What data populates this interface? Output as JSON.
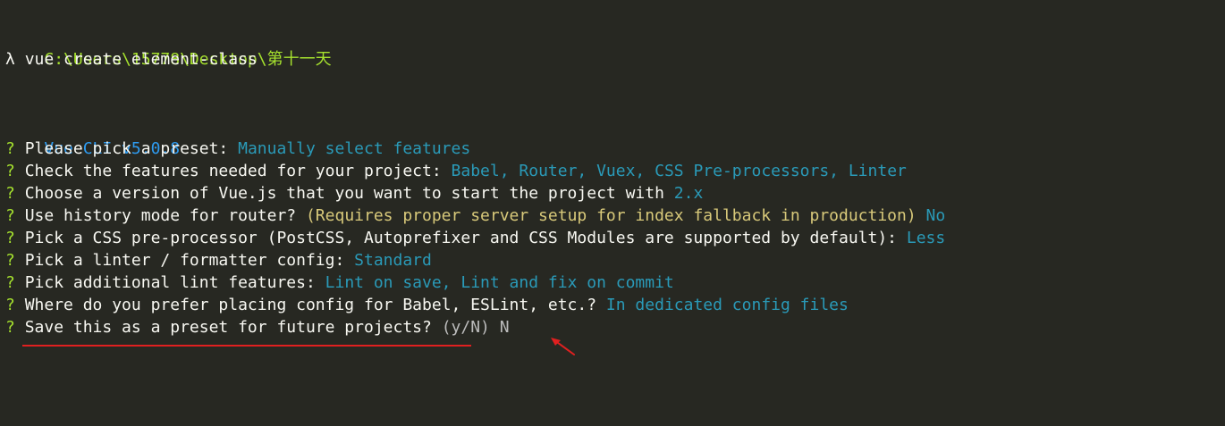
{
  "terminal": {
    "cwd": "C:\\Users\\15778\\Desktop\\第十一天",
    "prompt_symbol": "λ",
    "command": "vue create element-class",
    "cli_version": "Vue CLI v5.0.8",
    "question_mark": "?",
    "prompts": [
      {
        "question": "Please pick a preset:",
        "hint": "",
        "answer": "Manually select features"
      },
      {
        "question": "Check the features needed for your project:",
        "hint": "",
        "answer": "Babel, Router, Vuex, CSS Pre-processors, Linter"
      },
      {
        "question": "Choose a version of Vue.js that you want to start the project with",
        "hint": "",
        "answer": "2.x"
      },
      {
        "question": "Use history mode for router?",
        "hint": "(Requires proper server setup for index fallback in production)",
        "answer": "No"
      },
      {
        "question": "Pick a CSS pre-processor (PostCSS, Autoprefixer and CSS Modules are supported by default):",
        "hint": "",
        "answer": "Less"
      },
      {
        "question": "Pick a linter / formatter config:",
        "hint": "",
        "answer": "Standard"
      },
      {
        "question": "Pick additional lint features:",
        "hint": "",
        "answer": "Lint on save, Lint and fix on commit"
      },
      {
        "question": "Where do you prefer placing config for Babel, ESLint, etc.?",
        "hint": "",
        "answer": "In dedicated config files"
      }
    ],
    "current_prompt": {
      "question": "Save this as a preset for future projects?",
      "options": "(y/N)",
      "typed": "N"
    }
  },
  "annotations": {
    "underline_color": "#e02020",
    "arrow_color": "#e02020"
  }
}
